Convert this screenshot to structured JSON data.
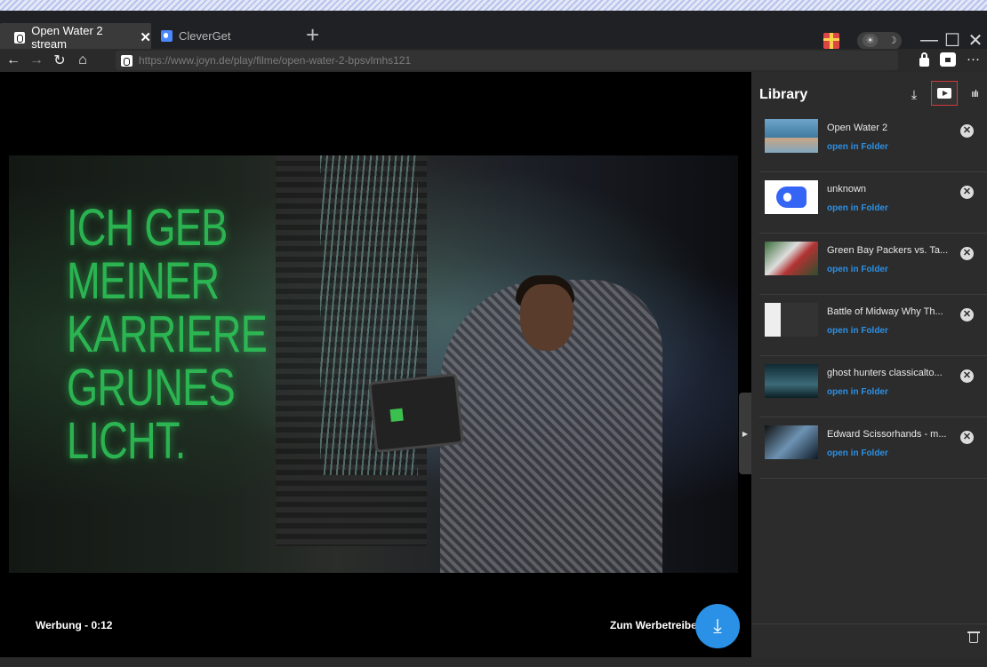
{
  "tabs": [
    {
      "label": "Open Water 2 stream",
      "close": "✕"
    },
    {
      "label": "CleverGet"
    }
  ],
  "new_tab": "+",
  "window": {
    "minimize": "—",
    "maximize": "☐",
    "close": "✕"
  },
  "theme_toggle": {
    "light": "☀",
    "dark": "☽"
  },
  "nav": {
    "back": "←",
    "forward": "→",
    "reload": "↻",
    "home": "⌂"
  },
  "address": {
    "url": "https://www.joyn.de/play/filme/open-water-2-bpsvlmhs121"
  },
  "more_menu": "···",
  "player": {
    "neon_text": "ICH GEB\nMEINER\nKARRIERE\nGRUNES\nLICHT.",
    "ad_label": "Werbung - 0:12",
    "ad_link": "Zum Werbetreibe",
    "download_fab": "⤓"
  },
  "library": {
    "title": "Library",
    "download_icon": "⤓",
    "audio_icon": "ıılı",
    "items": [
      {
        "title": "Open Water 2",
        "folder": "open in Folder"
      },
      {
        "title": "unknown",
        "folder": "open in Folder"
      },
      {
        "title": "Green Bay Packers vs. Ta...",
        "folder": "open in Folder"
      },
      {
        "title": "Battle of Midway Why Th...",
        "folder": "open in Folder"
      },
      {
        "title": "ghost hunters classicalto...",
        "folder": "open in Folder"
      },
      {
        "title": "Edward Scissorhands - m...",
        "folder": "open in Folder"
      }
    ],
    "remove_glyph": "✕"
  },
  "colors": {
    "accent": "#2b91e6",
    "highlight_border": "#d23a3a",
    "neon_green": "#2ecc5a"
  }
}
